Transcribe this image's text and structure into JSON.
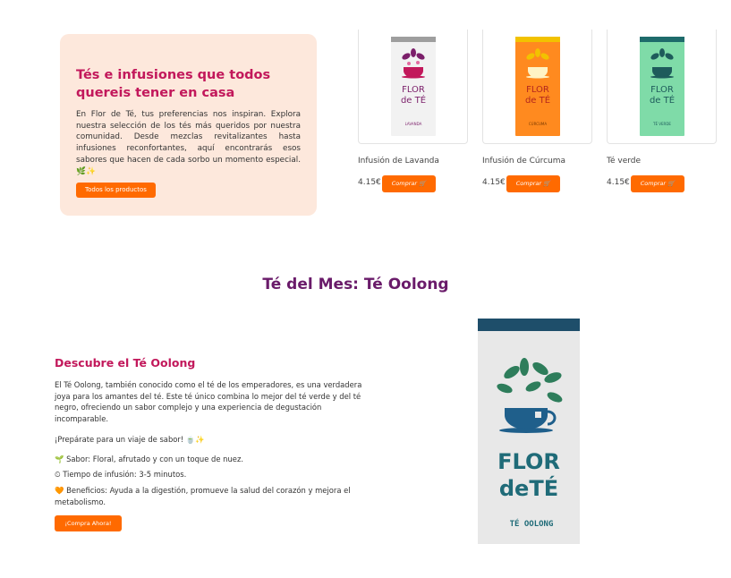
{
  "intro": {
    "title": "Tés e infusiones que todos quereis tener en casa",
    "text": "En Flor de Té, tus preferencias nos inspiran. Explora nuestra selección de los tés más queridos por nuestra comunidad. Desde mezclas revitalizantes hasta infusiones reconfortantes, aquí encontrarás esos sabores que hacen de cada sorbo un momento especial. 🌿✨",
    "button": "Todos los productos"
  },
  "products": [
    {
      "name": "Infusión de Lavanda",
      "price": "4.15€",
      "buy": "Comprar 🛒",
      "pack_label_1": "FLOR",
      "pack_label_2": "de TÉ",
      "pack_sub": "LAVANDA",
      "color_bg": "#f2f2f2",
      "color_cap": "#9e9e9e",
      "color_ink": "#7b1f6a"
    },
    {
      "name": "Infusión de Cúrcuma",
      "price": "4.15€",
      "buy": "Comprar 🛒",
      "pack_label_1": "FLOR",
      "pack_label_2": "de TÉ",
      "pack_sub": "CÚRCUMA",
      "color_bg": "#ff8a1f",
      "color_cap": "#f2c200",
      "color_ink": "#b3261e"
    },
    {
      "name": "Té verde",
      "price": "4.15€",
      "buy": "Comprar 🛒",
      "pack_label_1": "FLOR",
      "pack_label_2": "de TÉ",
      "pack_sub": "TÉ VERDE",
      "color_bg": "#7fdba8",
      "color_cap": "#1e6b6b",
      "color_ink": "#1e5b5b"
    }
  ],
  "month": {
    "title": "Té del Mes: Té Oolong",
    "desc_title": "Descubre el Té Oolong",
    "desc": "El Té Oolong, también conocido como el té de los emperadores, es una verdadera joya para los amantes del té. Este té único combina lo mejor del té verde y del té negro, ofreciendo un sabor complejo y una experiencia de degustación incomparable.",
    "ready": "¡Prepárate para un viaje de sabor! 🍵✨",
    "flavor": "🌱 Sabor: Floral, afrutado y con un toque de nuez.",
    "time": "⏲ Tiempo de infusión: 3-5 minutos.",
    "benefits": "🧡 Beneficios: Ayuda a la digestión, promueve la salud del corazón y mejora el metabolismo.",
    "button": "¡Compra Ahora!",
    "pack_label_1": "FLOR",
    "pack_label_2": "deTÉ",
    "pack_sub": "TÉ OOLONG",
    "color_ink": "#1f6b78"
  }
}
